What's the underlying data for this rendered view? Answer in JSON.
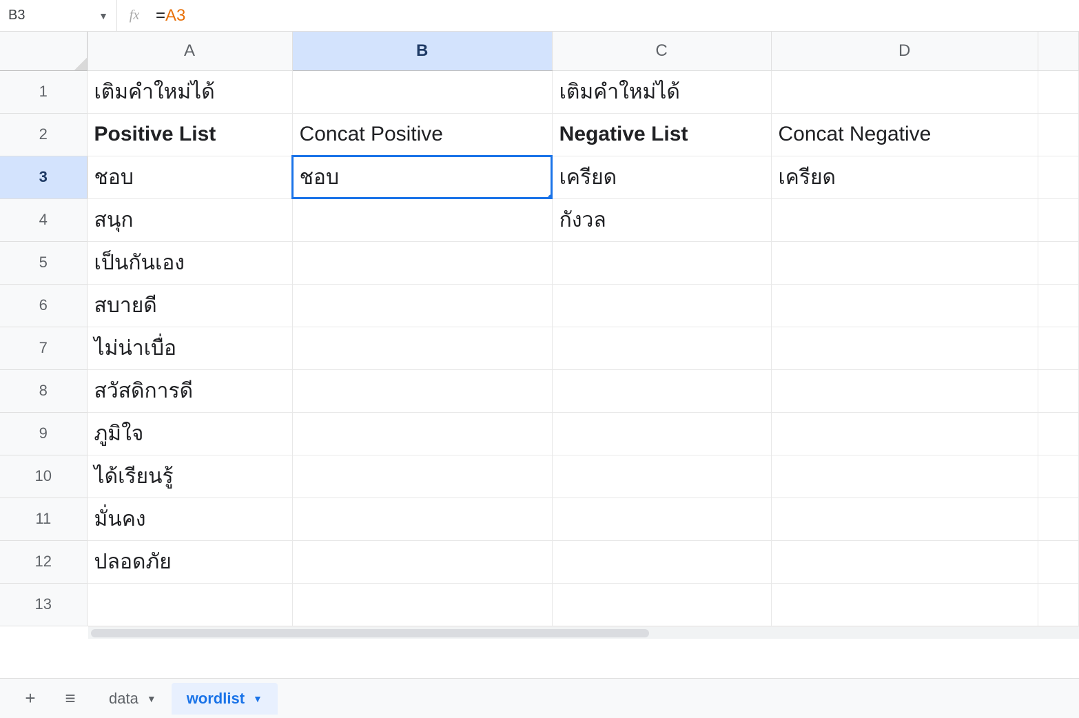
{
  "formula_bar": {
    "cell_ref": "B3",
    "fx_label": "fx",
    "formula_eq": "=",
    "formula_ref": "A3"
  },
  "columns": [
    "A",
    "B",
    "C",
    "D",
    ""
  ],
  "selected_column_index": 1,
  "rows": [
    "1",
    "2",
    "3",
    "4",
    "5",
    "6",
    "7",
    "8",
    "9",
    "10",
    "11",
    "12",
    "13"
  ],
  "selected_row_index": 2,
  "active_cell": "B3",
  "cells": {
    "A1": {
      "text": "เติมคำใหม่ได้",
      "class": "blue-text"
    },
    "C1": {
      "text": "เติมคำใหม่ได้",
      "class": "red-text"
    },
    "A2": {
      "text": "Positive List",
      "class": "blue-bold"
    },
    "B2": {
      "text": "Concat Positive",
      "class": "black-header"
    },
    "C2": {
      "text": "Negative List",
      "class": "red-bold"
    },
    "D2": {
      "text": "Concat Negative",
      "class": "black-header"
    },
    "A3": {
      "text": "ชอบ"
    },
    "B3": {
      "text": "ชอบ"
    },
    "C3": {
      "text": "เครียด"
    },
    "D3": {
      "text": "เครียด"
    },
    "A4": {
      "text": "สนุก"
    },
    "C4": {
      "text": "กังวล"
    },
    "A5": {
      "text": "เป็นกันเอง"
    },
    "A6": {
      "text": "สบายดี"
    },
    "A7": {
      "text": "ไม่น่าเบื่อ"
    },
    "A8": {
      "text": "สวัสดิการดี"
    },
    "A9": {
      "text": "ภูมิใจ"
    },
    "A10": {
      "text": "ได้เรียนรู้"
    },
    "A11": {
      "text": "มั่นคง"
    },
    "A12": {
      "text": "ปลอดภัย"
    }
  },
  "sheet_bar": {
    "add_icon": "+",
    "menu_icon": "≡",
    "tabs": [
      {
        "name": "data",
        "active": false
      },
      {
        "name": "wordlist",
        "active": true
      }
    ]
  }
}
